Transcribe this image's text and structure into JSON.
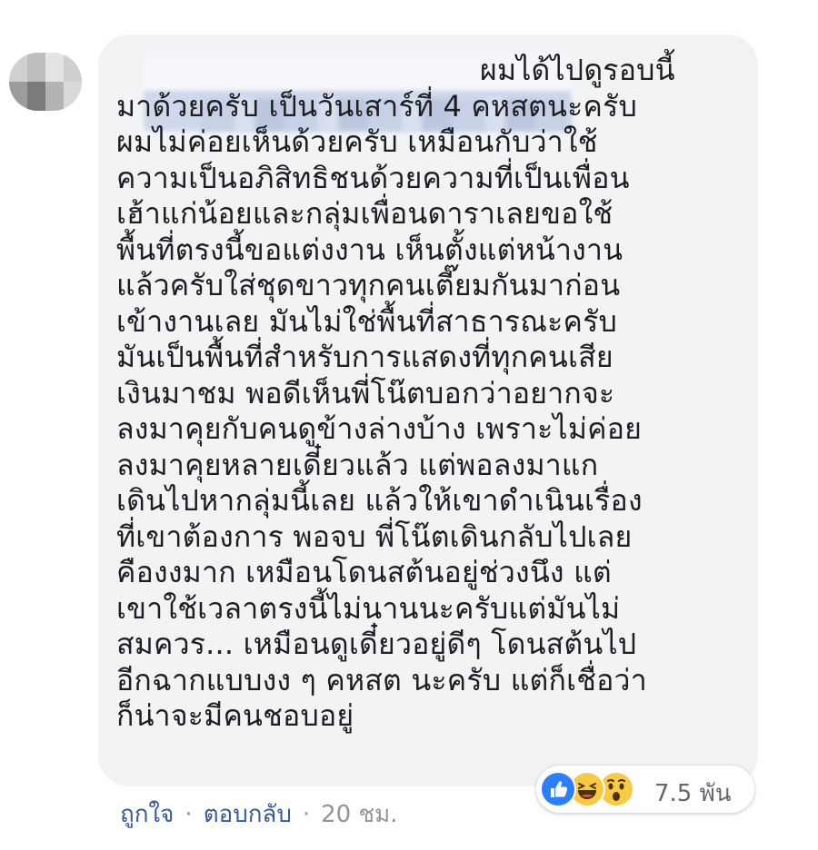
{
  "comment": {
    "lines": [
      "ผมได้ไปดูรอบนี้",
      "มาด้วยครับ เป็นวันเสาร์ที่ 4 คหสตนะครับ",
      "ผมไม่ค่อยเห็นด้วยครับ เหมือนกับว่าใช้",
      "ความเป็นอภิสิทธิชนด้วยความที่เป็นเพื่อน",
      "เฮ้าแก่น้อยและกลุ่มเพื่อนดาราเลยขอใช้",
      "พื้นที่ตรงนี้ขอแต่งงาน เห็นตั้งแต่หน้างาน",
      "แล้วครับใส่ชุดขาวทุกคนเตี๊ยมกันมาก่อน",
      "เข้างานเลย มันไม่ใช่พื้นที่สาธารณะครับ",
      "มันเป็นพื้นที่สำหรับการแสดงที่ทุกคนเสีย",
      "เงินมาชม พอดีเห็นพี่โน๊ตบอกว่าอยากจะ",
      "ลงมาคุยกับคนดูข้างล่างบ้าง เพราะไม่ค่อย",
      "ลงมาคุยหลายเดี๋ยวแล้ว แต่พอลงมาแก",
      "เดินไปหากลุ่มนี้เลย แล้วให้เขาดำเนินเรื่อง",
      "ที่เขาต้องการ พอจบ พี่โน๊ตเดินกลับไปเลย",
      "คืองงมาก เหมือนโดนสต้นอยู่ช่วงนึง แต่",
      "เขาใช้เวลาตรงนี้ไม่นานนะครับแต่มันไม่",
      "สมควร... เหมือนดูเดี๋ยวอยู่ดีๆ โดนสต้นไป",
      "อีกฉากแบบงง ๆ คหสต นะครับ แต่ก็เชื่อว่า",
      "ก็น่าจะมีคนชอบอยู่"
    ]
  },
  "reactions": {
    "icons": [
      "like-icon",
      "haha-icon",
      "wow-icon"
    ],
    "count": "7.5 พัน"
  },
  "actions": {
    "like": "ถูกใจ",
    "separator": "·",
    "reply": "ตอบกลับ",
    "time": "20 ชม."
  },
  "colors": {
    "bubble": "#f2f3f5",
    "link": "#385898",
    "text": "#1c1e21",
    "like_blue": "#2d7ff9",
    "emoji_yellow": "#f7c947"
  }
}
